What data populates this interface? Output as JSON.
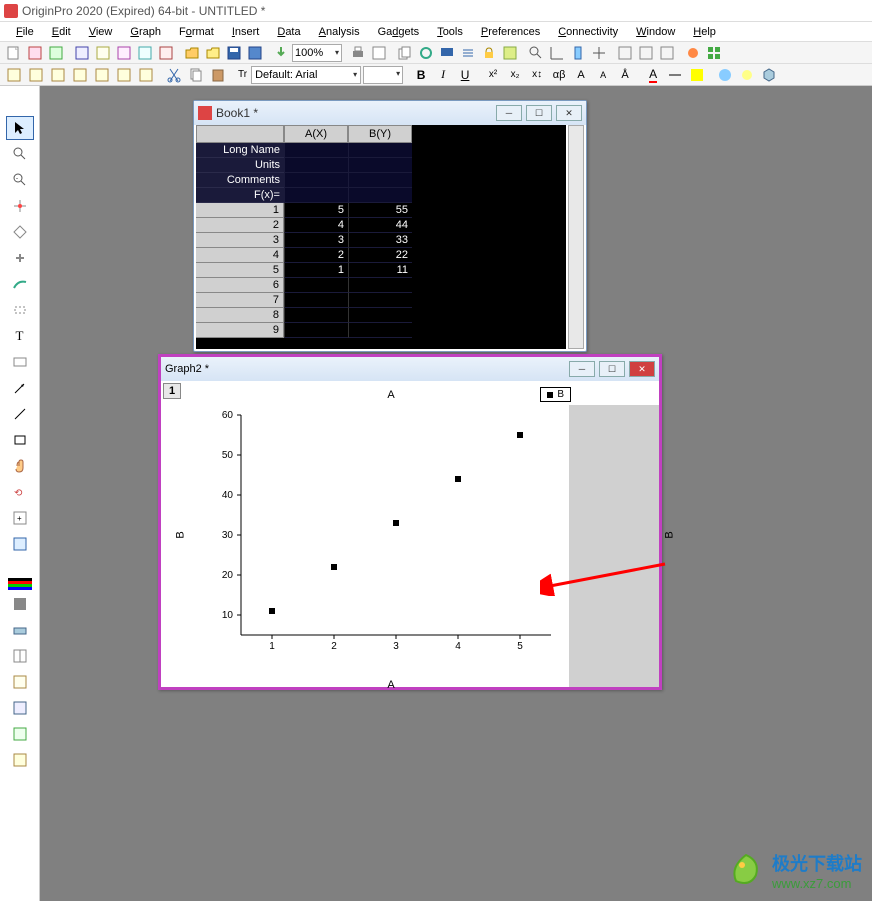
{
  "app": {
    "title": "OriginPro 2020 (Expired) 64-bit - UNTITLED *"
  },
  "menu": [
    "File",
    "Edit",
    "View",
    "Graph",
    "Format",
    "Insert",
    "Data",
    "Analysis",
    "Gadgets",
    "Tools",
    "Preferences",
    "Connectivity",
    "Window",
    "Help"
  ],
  "toolbar": {
    "zoom": "100%"
  },
  "format": {
    "font": "Default: Arial"
  },
  "book": {
    "title": "Book1 *",
    "col_headers": [
      "A(X)",
      "B(Y)"
    ],
    "row_labels": [
      "Long Name",
      "Units",
      "Comments",
      "F(x)="
    ],
    "meta": {
      "longname": [
        "",
        ""
      ],
      "units": [
        "",
        ""
      ],
      "comments": [
        "",
        ""
      ],
      "fx": [
        "",
        ""
      ]
    },
    "row_nums": [
      "1",
      "2",
      "3",
      "4",
      "5",
      "6",
      "7",
      "8",
      "9"
    ],
    "data": {
      "A": [
        "5",
        "4",
        "3",
        "2",
        "1",
        "",
        "",
        "",
        ""
      ],
      "B": [
        "55",
        "44",
        "33",
        "22",
        "11",
        "",
        "",
        "",
        ""
      ]
    }
  },
  "graph": {
    "title": "Graph2 *",
    "layer": "1",
    "plot_title": "A",
    "legend_label": "B",
    "xlabel": "A",
    "ylabel_left": "B",
    "ylabel_right": "B",
    "xticks": [
      "1",
      "2",
      "3",
      "4",
      "5"
    ],
    "yticks": [
      "10",
      "20",
      "30",
      "40",
      "50",
      "60"
    ]
  },
  "chart_data": {
    "type": "scatter",
    "title": "A",
    "xlabel": "A",
    "ylabel": "B",
    "xlim": [
      0.5,
      5.5
    ],
    "ylim": [
      5,
      60
    ],
    "series": [
      {
        "name": "B",
        "x": [
          1,
          2,
          3,
          4,
          5
        ],
        "y": [
          11,
          22,
          33,
          44,
          55
        ]
      }
    ],
    "xticks": [
      1,
      2,
      3,
      4,
      5
    ],
    "yticks": [
      10,
      20,
      30,
      40,
      50,
      60
    ],
    "legend_position": "top-right",
    "grid": false
  },
  "watermark": {
    "line1": "极光下载站",
    "line2": "www.xz7.com"
  }
}
